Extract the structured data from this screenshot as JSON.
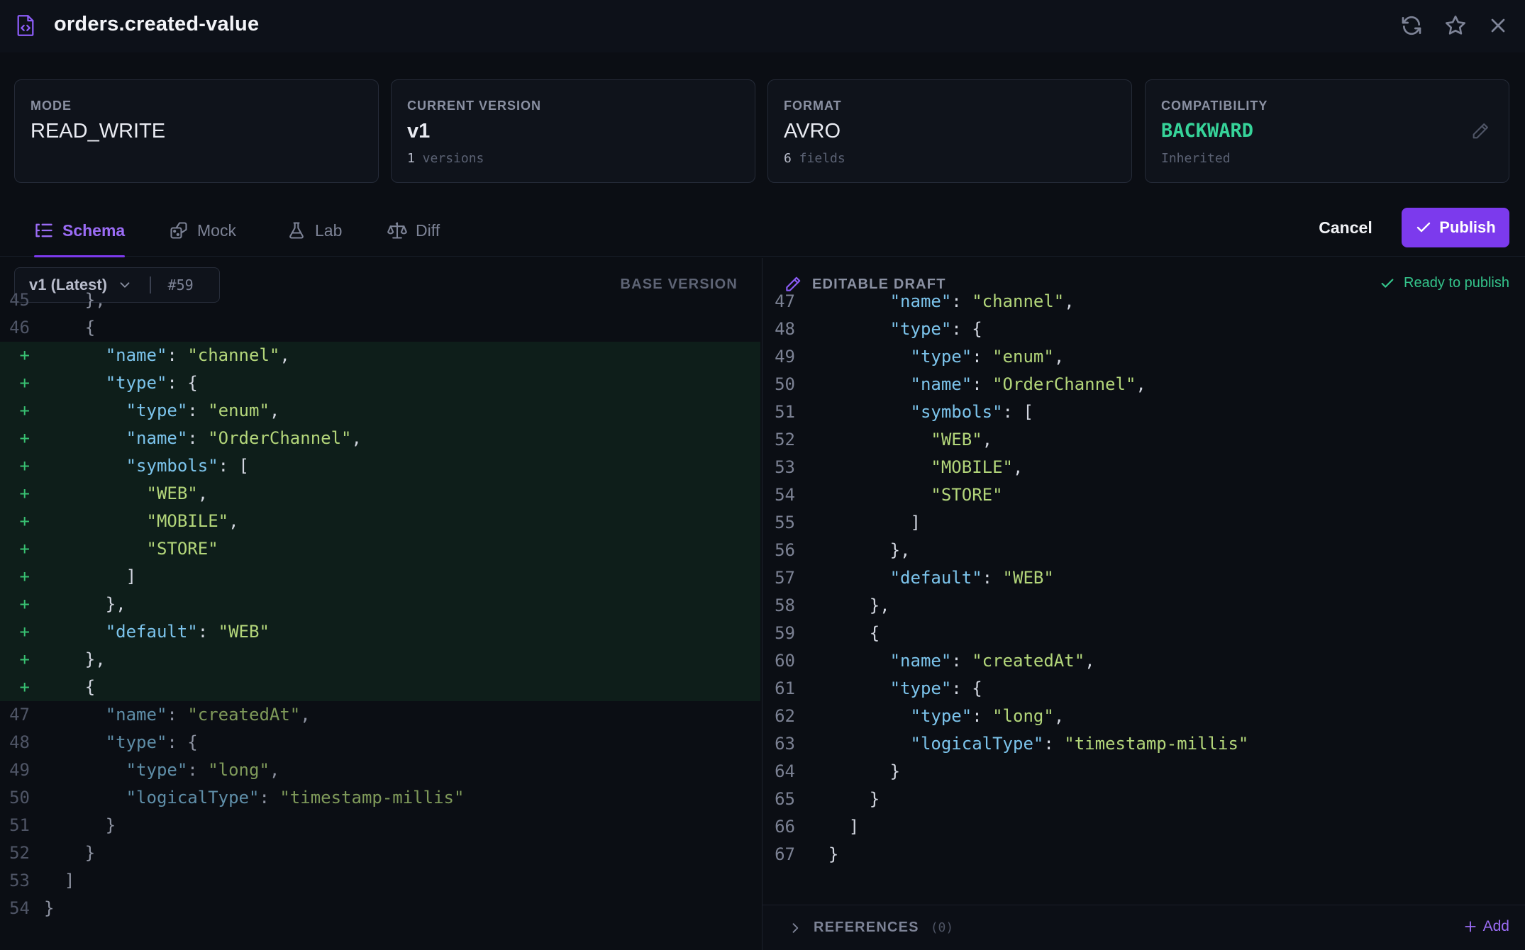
{
  "header": {
    "title": "orders.created-value",
    "icons": [
      "file-code-icon",
      "refresh-icon",
      "star-icon",
      "close-icon"
    ]
  },
  "cards": {
    "mode": {
      "label": "MODE",
      "value": "READ_WRITE"
    },
    "version": {
      "label": "CURRENT VERSION",
      "value": "v1",
      "sub_count": "1",
      "sub_text": " versions"
    },
    "format": {
      "label": "FORMAT",
      "value": "AVRO",
      "sub_count": "6",
      "sub_text": " fields"
    },
    "compat": {
      "label": "COMPATIBILITY",
      "value": "BACKWARD",
      "sub_text": "Inherited",
      "color": "#36d399"
    }
  },
  "tabs": [
    {
      "label": "Schema",
      "icon": "list-tree-icon",
      "active": true
    },
    {
      "label": "Mock",
      "icon": "dice-icon",
      "active": false
    },
    {
      "label": "Lab",
      "icon": "flask-icon",
      "active": false
    },
    {
      "label": "Diff",
      "icon": "scale-icon",
      "active": false
    }
  ],
  "actions": {
    "cancel": "Cancel",
    "publish": "Publish"
  },
  "left_pane": {
    "version_select": "v1 (Latest)",
    "version_id": "#59",
    "heading": "BASE VERSION",
    "lines": [
      {
        "n": "45",
        "t": "    },",
        "added": false
      },
      {
        "n": "46",
        "t": "    {",
        "added": false
      },
      {
        "n": "+",
        "t": "      \"name\": \"channel\",",
        "added": true
      },
      {
        "n": "+",
        "t": "      \"type\": {",
        "added": true
      },
      {
        "n": "+",
        "t": "        \"type\": \"enum\",",
        "added": true
      },
      {
        "n": "+",
        "t": "        \"name\": \"OrderChannel\",",
        "added": true
      },
      {
        "n": "+",
        "t": "        \"symbols\": [",
        "added": true
      },
      {
        "n": "+",
        "t": "          \"WEB\",",
        "added": true
      },
      {
        "n": "+",
        "t": "          \"MOBILE\",",
        "added": true
      },
      {
        "n": "+",
        "t": "          \"STORE\"",
        "added": true
      },
      {
        "n": "+",
        "t": "        ]",
        "added": true
      },
      {
        "n": "+",
        "t": "      },",
        "added": true
      },
      {
        "n": "+",
        "t": "      \"default\": \"WEB\"",
        "added": true
      },
      {
        "n": "+",
        "t": "    },",
        "added": true
      },
      {
        "n": "+",
        "t": "    {",
        "added": true
      },
      {
        "n": "47",
        "t": "      \"name\": \"createdAt\",",
        "added": false
      },
      {
        "n": "48",
        "t": "      \"type\": {",
        "added": false
      },
      {
        "n": "49",
        "t": "        \"type\": \"long\",",
        "added": false
      },
      {
        "n": "50",
        "t": "        \"logicalType\": \"timestamp-millis\"",
        "added": false
      },
      {
        "n": "51",
        "t": "      }",
        "added": false
      },
      {
        "n": "52",
        "t": "    }",
        "added": false
      },
      {
        "n": "53",
        "t": "  ]",
        "added": false
      },
      {
        "n": "54",
        "t": "}",
        "added": false
      }
    ]
  },
  "right_pane": {
    "heading": "EDITABLE DRAFT",
    "status": "Ready to publish",
    "lines": [
      {
        "n": "47",
        "t": "        \"name\": \"channel\","
      },
      {
        "n": "48",
        "t": "        \"type\": {"
      },
      {
        "n": "49",
        "t": "          \"type\": \"enum\","
      },
      {
        "n": "50",
        "t": "          \"name\": \"OrderChannel\","
      },
      {
        "n": "51",
        "t": "          \"symbols\": ["
      },
      {
        "n": "52",
        "t": "            \"WEB\","
      },
      {
        "n": "53",
        "t": "            \"MOBILE\","
      },
      {
        "n": "54",
        "t": "            \"STORE\""
      },
      {
        "n": "55",
        "t": "          ]"
      },
      {
        "n": "56",
        "t": "        },"
      },
      {
        "n": "57",
        "t": "        \"default\": \"WEB\""
      },
      {
        "n": "58",
        "t": "      },"
      },
      {
        "n": "59",
        "t": "      {"
      },
      {
        "n": "60",
        "t": "        \"name\": \"createdAt\","
      },
      {
        "n": "61",
        "t": "        \"type\": {"
      },
      {
        "n": "62",
        "t": "          \"type\": \"long\","
      },
      {
        "n": "63",
        "t": "          \"logicalType\": \"timestamp-millis\""
      },
      {
        "n": "64",
        "t": "        }"
      },
      {
        "n": "65",
        "t": "      }"
      },
      {
        "n": "66",
        "t": "    ]"
      },
      {
        "n": "67",
        "t": "  }"
      }
    ],
    "references": {
      "label": "REFERENCES",
      "count": "(0)",
      "add": "Add"
    }
  },
  "colors": {
    "accent": "#7c3aed",
    "success": "#34c48b",
    "added_bg": "#0e1e1a"
  }
}
